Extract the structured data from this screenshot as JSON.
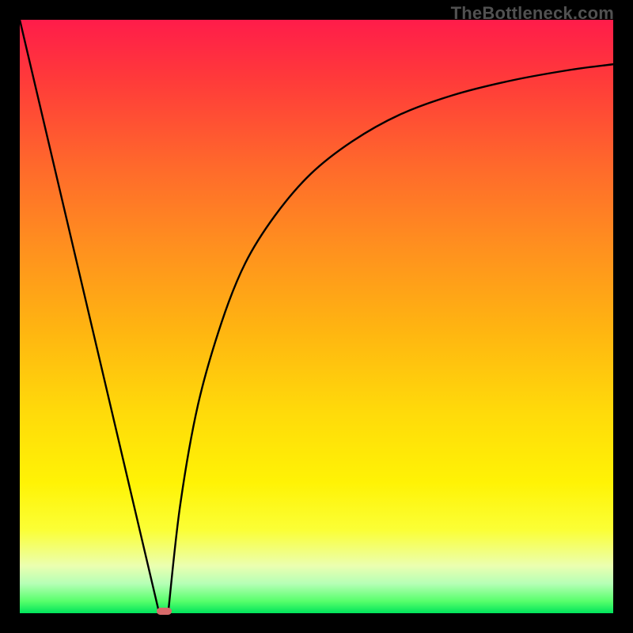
{
  "watermark": "TheBottleneck.com",
  "chart_data": {
    "type": "line",
    "title": "",
    "xlabel": "",
    "ylabel": "",
    "xlim": [
      0,
      100
    ],
    "ylim": [
      0,
      100
    ],
    "series": [
      {
        "name": "left-branch",
        "x": [
          0,
          23.5
        ],
        "values": [
          100,
          0
        ]
      },
      {
        "name": "right-branch",
        "x": [
          25,
          27,
          30,
          34,
          38,
          43,
          49,
          56,
          64,
          73,
          83,
          93,
          100
        ],
        "values": [
          0,
          18,
          35,
          49,
          59,
          67,
          74,
          79.5,
          84,
          87.3,
          89.8,
          91.6,
          92.5
        ]
      }
    ],
    "marker": {
      "x": 24.3,
      "y": 0.3,
      "width_pct": 2.6,
      "height_pct": 1.2,
      "color": "#d86a6a"
    },
    "grid": false,
    "legend": false
  }
}
